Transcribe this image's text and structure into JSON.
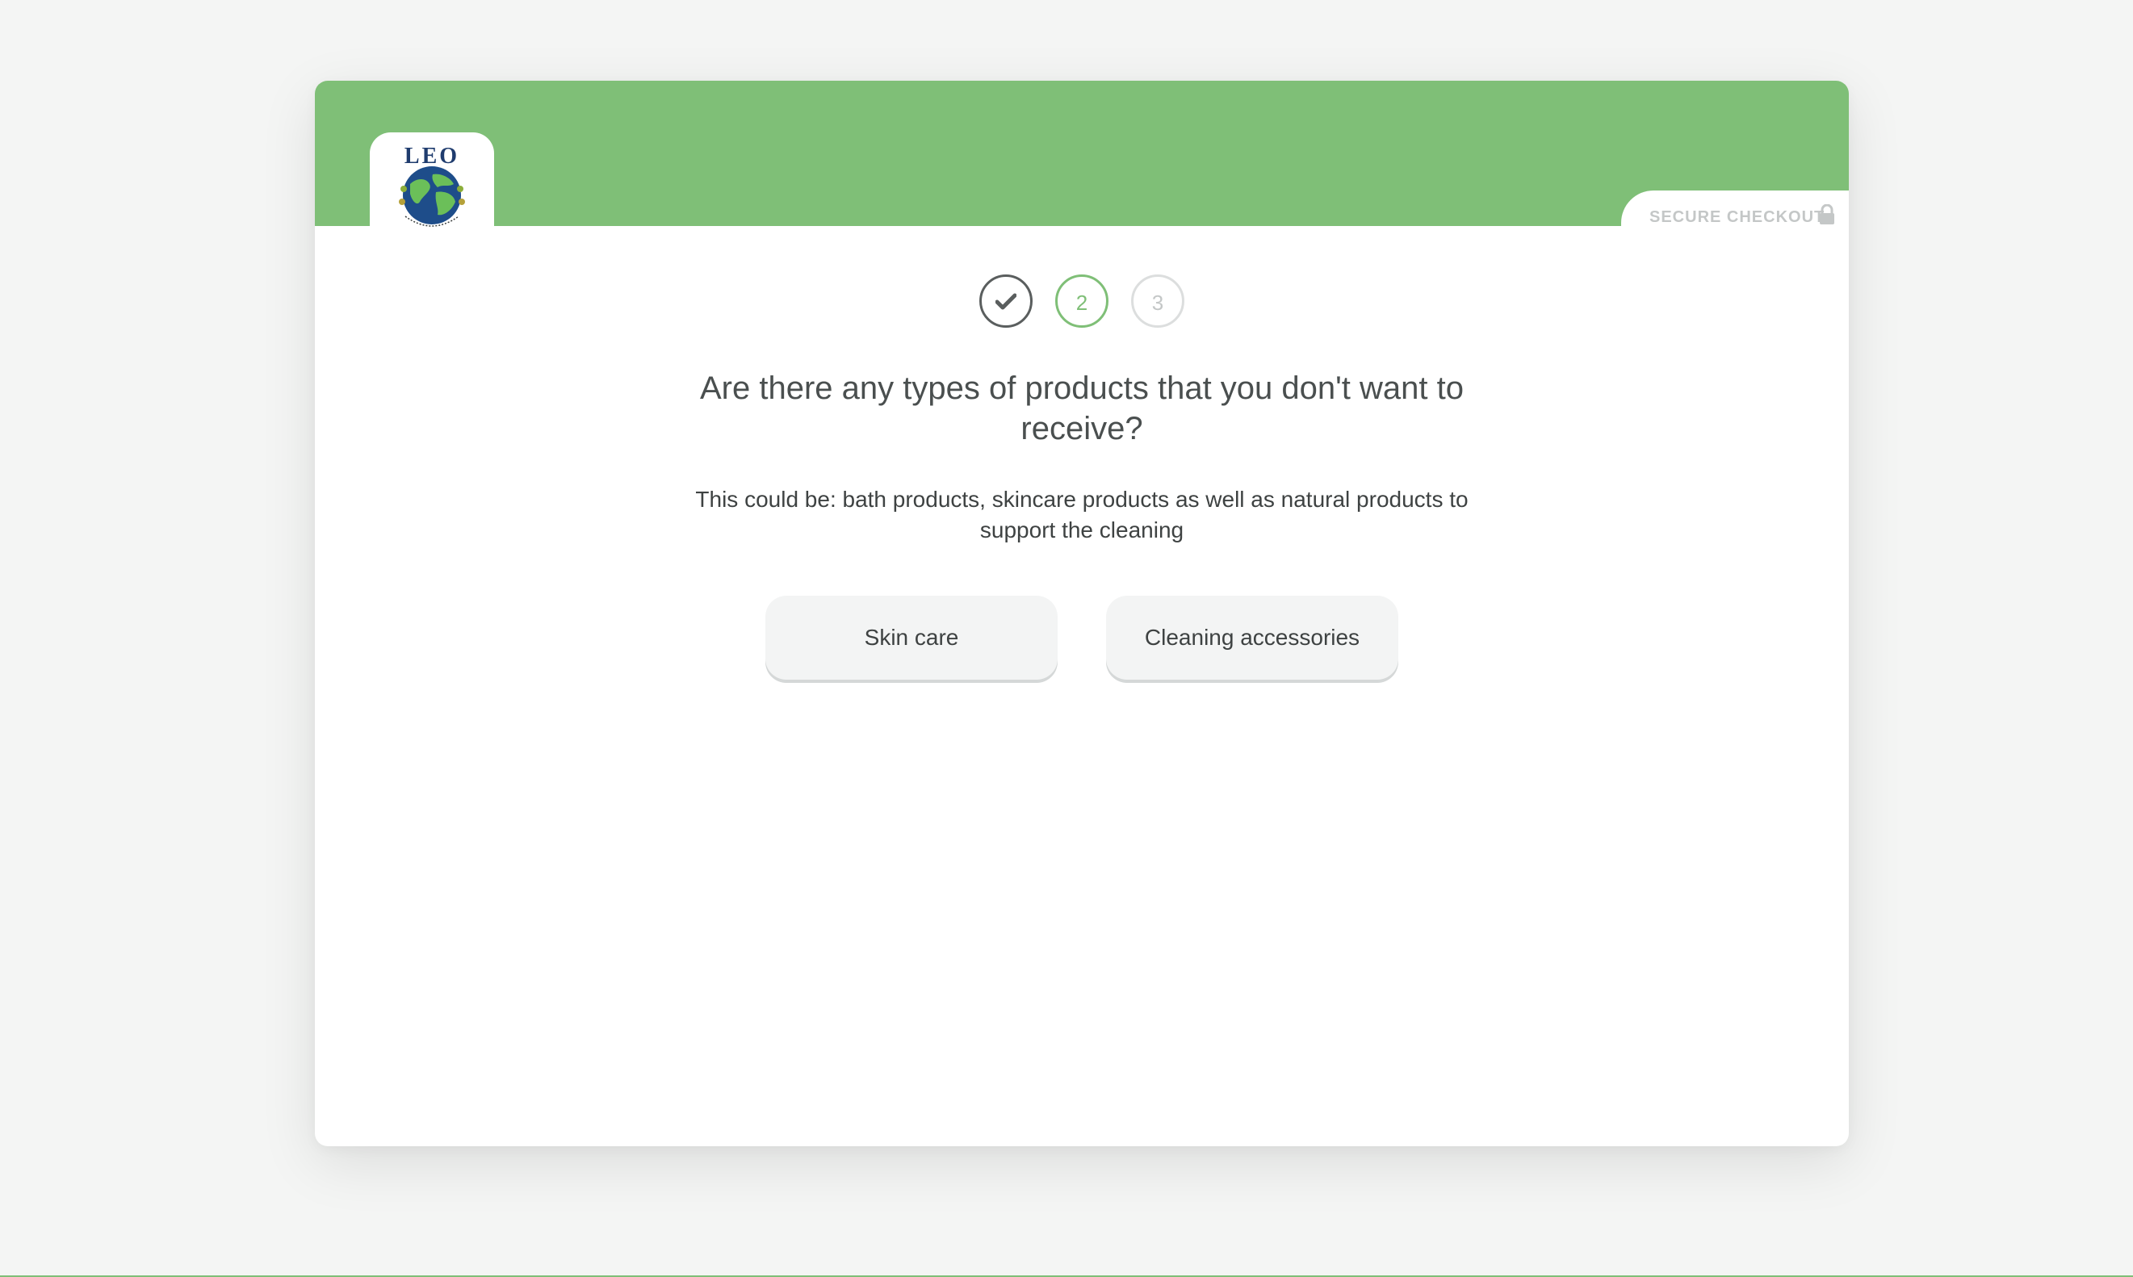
{
  "logo": {
    "text": "LEO",
    "tagline": "Loving Earth's Oceans"
  },
  "header": {
    "secure_checkout": "SECURE CHECKOUT"
  },
  "steps": [
    {
      "label": "",
      "state": "done",
      "icon": "check-icon"
    },
    {
      "label": "2",
      "state": "current"
    },
    {
      "label": "3",
      "state": "future"
    }
  ],
  "question": {
    "title": "Are there any types of products that you don't want to receive?",
    "description": "This could be: bath products, skincare products as well as natural products to support the cleaning"
  },
  "options": [
    {
      "label": "Skin care"
    },
    {
      "label": "Cleaning accessories"
    }
  ],
  "colors": {
    "accent": "#7fbf77",
    "background": "#f4f5f4",
    "text": "#3e4242",
    "muted": "#c4c7c7"
  }
}
